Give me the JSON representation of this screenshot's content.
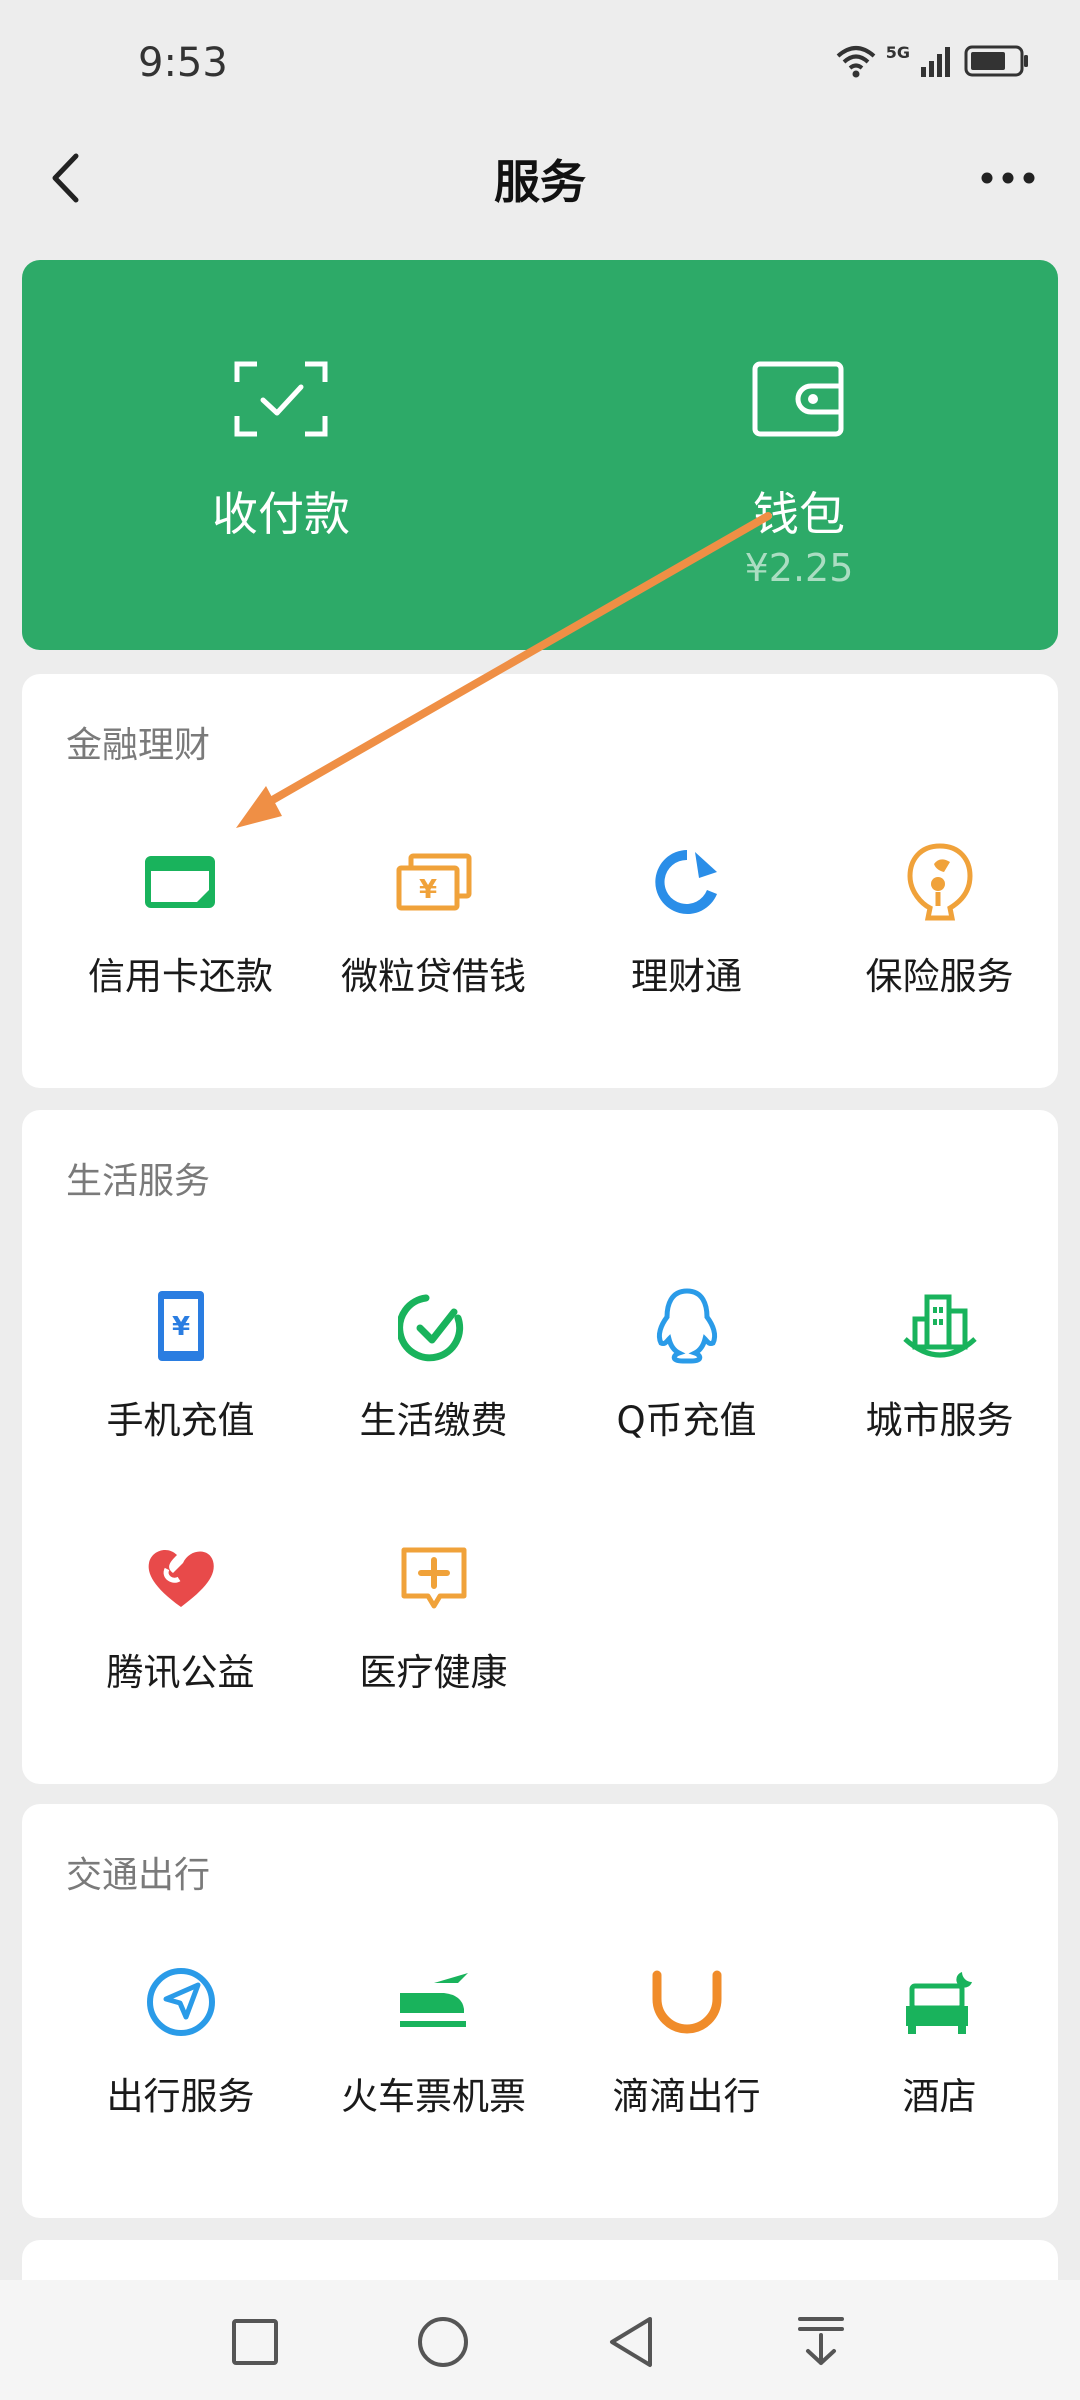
{
  "status_bar": {
    "time": "9:53",
    "network": "5G"
  },
  "nav": {
    "title": "服务"
  },
  "wallet_card": {
    "pay": {
      "label": "收付款"
    },
    "wallet": {
      "label": "钱包",
      "balance": "¥2.25"
    }
  },
  "finance": {
    "title": "金融理财",
    "items": [
      {
        "label": "信用卡还款",
        "icon": "credit-card-icon",
        "color": "#19b35c"
      },
      {
        "label": "微粒贷借钱",
        "icon": "loan-cash-icon",
        "color": "#f0a23a"
      },
      {
        "label": "理财通",
        "icon": "wealth-icon",
        "color": "#2a8ee8"
      },
      {
        "label": "保险服务",
        "icon": "insurance-umbrella-icon",
        "color": "#f0a23a"
      }
    ]
  },
  "life": {
    "title": "生活服务",
    "items": [
      {
        "label": "手机充值",
        "icon": "phone-topup-icon",
        "color": "#2a7de1"
      },
      {
        "label": "生活缴费",
        "icon": "bill-payment-icon",
        "color": "#19b35c"
      },
      {
        "label": "Q币充值",
        "icon": "qq-penguin-icon",
        "color": "#2a9be8"
      },
      {
        "label": "城市服务",
        "icon": "city-buildings-icon",
        "color": "#19b35c"
      },
      {
        "label": "腾讯公益",
        "icon": "charity-heart-icon",
        "color": "#e84a4a"
      },
      {
        "label": "医疗健康",
        "icon": "medical-cross-icon",
        "color": "#f0a23a"
      }
    ]
  },
  "transport": {
    "title": "交通出行",
    "items": [
      {
        "label": "出行服务",
        "icon": "navigation-icon",
        "color": "#2a9be8"
      },
      {
        "label": "火车票机票",
        "icon": "train-plane-icon",
        "color": "#19b35c"
      },
      {
        "label": "滴滴出行",
        "icon": "didi-icon",
        "color": "#f08c2a"
      },
      {
        "label": "酒店",
        "icon": "hotel-bed-icon",
        "color": "#19b35c"
      }
    ]
  },
  "colors": {
    "wallet_green": "#2daa68",
    "annotation_arrow": "#ef8f45",
    "page_bg": "#ededed"
  }
}
